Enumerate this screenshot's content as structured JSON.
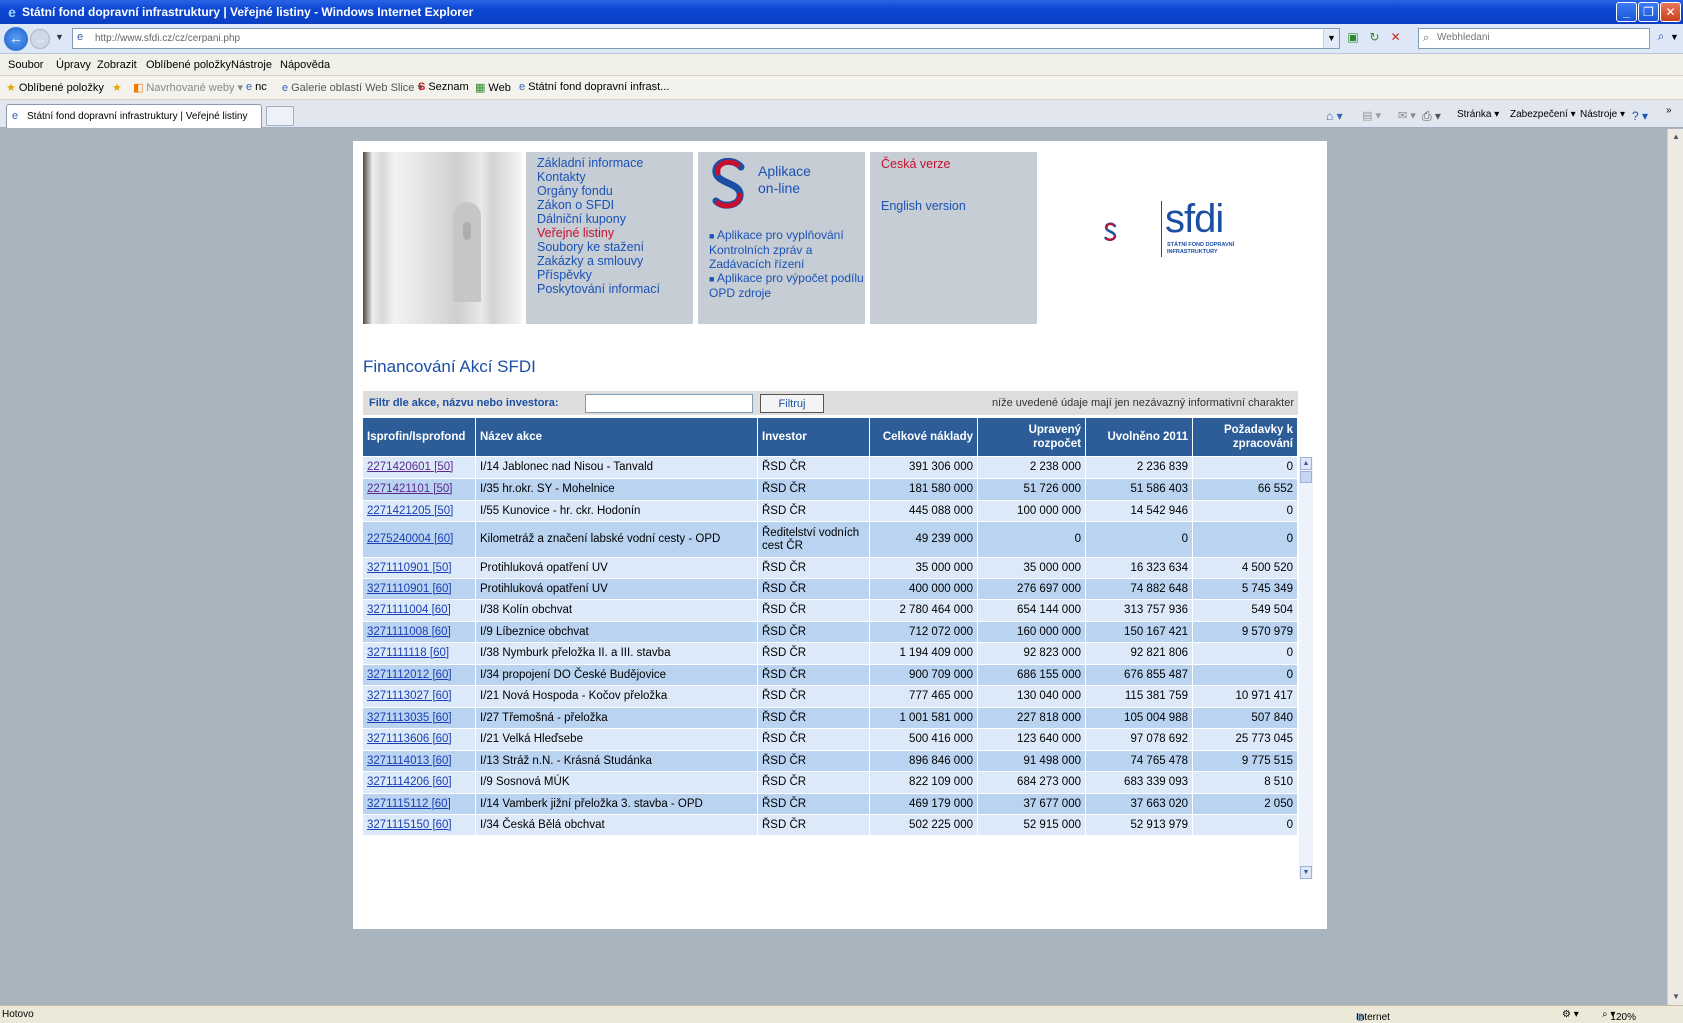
{
  "window": {
    "title": "Státní fond dopravní infrastruktury | Veřejné listiny - Windows Internet Explorer",
    "minimize": "_",
    "maximize": "❐",
    "close": "✕"
  },
  "address": {
    "url": "http://www.sfdi.cz/cz/cerpani.php",
    "search_placeholder": "Webhledani"
  },
  "menu": [
    "Soubor",
    "Úpravy",
    "Zobrazit",
    "Oblíbené položky",
    "Nástroje",
    "Nápověda"
  ],
  "favorites": {
    "label": "Oblíbené položky",
    "items": [
      "Navrhované weby ▾",
      "nc",
      "Galerie oblastí Web Slice ▾",
      "Seznam",
      "Web",
      "Státní fond dopravní infrast..."
    ]
  },
  "tab": {
    "label": "Státní fond dopravní infrastruktury | Veřejné listiny"
  },
  "commands": [
    "Stránka ▾",
    "Zabezpečení ▾",
    "Nástroje ▾"
  ],
  "site": {
    "nav": [
      {
        "label": "Základní informace",
        "active": false
      },
      {
        "label": "Kontakty",
        "active": false
      },
      {
        "label": "Orgány fondu",
        "active": false
      },
      {
        "label": "Zákon o SFDI",
        "active": false
      },
      {
        "label": "Dálniční kupony",
        "active": false
      },
      {
        "label": "Veřejné listiny",
        "active": true
      },
      {
        "label": "Soubory ke stažení",
        "active": false
      },
      {
        "label": "Zakázky a smlouvy",
        "active": false
      },
      {
        "label": "Příspěvky",
        "active": false
      },
      {
        "label": "Poskytování informací",
        "active": false
      }
    ],
    "apps": {
      "title_line1": "Aplikace",
      "title_line2": "on-line",
      "link1": "Aplikace pro vyplňování Kontrolních zpráv a Zadávacích řízení",
      "link2": "Aplikace pro výpočet podílu OPD zdroje"
    },
    "lang_cz": "Česká verze",
    "lang_en": "English version",
    "logo_text": "sfdi",
    "logo_sub": "STÁTNÍ FOND DOPRAVNÍ INFRASTRUKTURY",
    "page_title": "Financování Akcí SFDI",
    "filter_label": "Filtr dle akce, názvu nebo investora:",
    "filter_button": "Filtruj",
    "filter_note": "níže uvedené údaje mají jen nezávazný informativní charakter"
  },
  "table": {
    "headers": [
      "Isprofin/Isprofond",
      "Název akce",
      "Investor",
      "Celkové náklady",
      "Upravený rozpočet",
      "Uvolněno 2011",
      "Požadavky k zpracování"
    ],
    "rows": [
      [
        "2271420601 [50]",
        "I/14 Jablonec nad Nisou - Tanvald",
        "ŘSD ČR",
        "391 306 000",
        "2 238 000",
        "2 236 839",
        "0"
      ],
      [
        "2271421101 [50]",
        "I/35 hr.okr. SY - Mohelnice",
        "ŘSD ČR",
        "181 580 000",
        "51 726 000",
        "51 586 403",
        "66 552"
      ],
      [
        "2271421205 [50]",
        "I/55 Kunovice - hr. ckr. Hodonín",
        "ŘSD ČR",
        "445 088 000",
        "100 000 000",
        "14 542 946",
        "0"
      ],
      [
        "2275240004 [60]",
        "Kilometráž a značení labské vodní cesty - OPD",
        "Ředitelství vodních cest ČR",
        "49 239 000",
        "0",
        "0",
        "0"
      ],
      [
        "3271110901 [50]",
        "Protihluková opatření UV",
        "ŘSD ČR",
        "35 000 000",
        "35 000 000",
        "16 323 634",
        "4 500 520"
      ],
      [
        "3271110901 [60]",
        "Protihluková opatření UV",
        "ŘSD ČR",
        "400 000 000",
        "276 697 000",
        "74 882 648",
        "5 745 349"
      ],
      [
        "3271111004 [60]",
        "I/38 Kolín obchvat",
        "ŘSD ČR",
        "2 780 464 000",
        "654 144 000",
        "313 757 936",
        "549 504"
      ],
      [
        "3271111008 [60]",
        "I/9 Líbeznice obchvat",
        "ŘSD ČR",
        "712 072 000",
        "160 000 000",
        "150 167 421",
        "9 570 979"
      ],
      [
        "3271111118 [60]",
        "I/38 Nymburk přeložka II. a III. stavba",
        "ŘSD ČR",
        "1 194 409 000",
        "92 823 000",
        "92 821 806",
        "0"
      ],
      [
        "3271112012 [60]",
        "I/34 propojení DO České Budějovice",
        "ŘSD ČR",
        "900 709 000",
        "686 155 000",
        "676 855 487",
        "0"
      ],
      [
        "3271113027 [60]",
        "I/21 Nová Hospoda - Kočov přeložka",
        "ŘSD ČR",
        "777 465 000",
        "130 040 000",
        "115 381 759",
        "10 971 417"
      ],
      [
        "3271113035 [60]",
        "I/27 Třemošná - přeložka",
        "ŘSD ČR",
        "1 001 581 000",
        "227 818 000",
        "105 004 988",
        "507 840"
      ],
      [
        "3271113606 [60]",
        "I/21 Velká Hleďsebe",
        "ŘSD ČR",
        "500 416 000",
        "123 640 000",
        "97 078 692",
        "25 773 045"
      ],
      [
        "3271114013 [60]",
        "I/13 Stráž n.N. - Krásná Studánka",
        "ŘSD ČR",
        "896 846 000",
        "91 498 000",
        "74 765 478",
        "9 775 515"
      ],
      [
        "3271114206 [60]",
        "I/9 Sosnová MÚK",
        "ŘSD ČR",
        "822 109 000",
        "684 273 000",
        "683 339 093",
        "8 510"
      ],
      [
        "3271115112 [60]",
        "I/14 Vamberk jižní přeložka 3. stavba - OPD",
        "ŘSD ČR",
        "469 179 000",
        "37 677 000",
        "37 663 020",
        "2 050"
      ],
      [
        "3271115150 [60]",
        "I/34 Česká Bělá obchvat",
        "ŘSD ČR",
        "502 225 000",
        "52 915 000",
        "52 913 979",
        "0"
      ]
    ]
  },
  "status": {
    "left": "Hotovo",
    "zone": "Internet",
    "zoom": "120%"
  },
  "colors": {
    "accent": "#1a4fa3",
    "active_link": "#c8102e",
    "header_bg": "#2c5d98"
  }
}
